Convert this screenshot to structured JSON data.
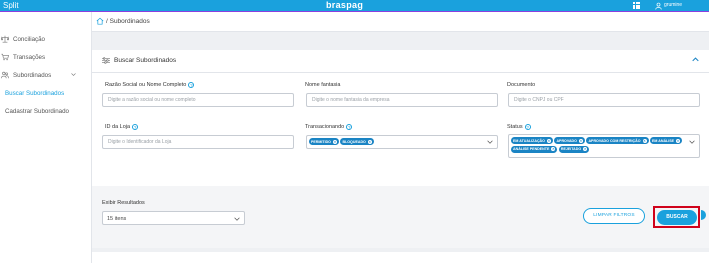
{
  "topbar": {
    "app_name": "Split",
    "brand": "braspag",
    "user_name": "grumine"
  },
  "sidebar": {
    "items": [
      {
        "label": "Conciliação"
      },
      {
        "label": "Transações"
      },
      {
        "label": "Subordinados"
      }
    ],
    "subitems": [
      {
        "label": "Buscar Subordinados"
      },
      {
        "label": "Cadastrar Subordinado"
      }
    ]
  },
  "breadcrumb": {
    "text": "/ Subordinados"
  },
  "panel": {
    "title": "Buscar Subordinados",
    "fields": {
      "razao": {
        "label": "Razão Social ou Nome Completo",
        "placeholder": "Digite a razão social ou nome completo"
      },
      "fantasia": {
        "label": "Nome fantasia",
        "placeholder": "Digite o nome fantasia da empresa"
      },
      "documento": {
        "label": "Documento",
        "placeholder": "Digite o CNPJ ou CPF"
      },
      "id_loja": {
        "label": "ID da Loja",
        "placeholder": "Digite o Identificador da Loja"
      },
      "transacionando": {
        "label": "Transacionando",
        "tags": [
          "PERMITIDO",
          "BLOQUEADO"
        ]
      },
      "status": {
        "label": "Status",
        "tags": [
          "EM ATUALIZAÇÃO",
          "APROVADO",
          "APROVADO COM RESTRIÇÃO",
          "EM ANÁLISE",
          "ANÁLISE PENDENTE",
          "REJEITADO"
        ]
      }
    },
    "results": {
      "label": "Exibir Resultados",
      "value": "15 itens"
    },
    "buttons": {
      "clear": "LIMPAR FILTROS",
      "search": "BUSCAR"
    }
  },
  "colors": {
    "primary": "#1aa1dd",
    "tag": "#1a84c4",
    "highlight": "#d0021b"
  }
}
